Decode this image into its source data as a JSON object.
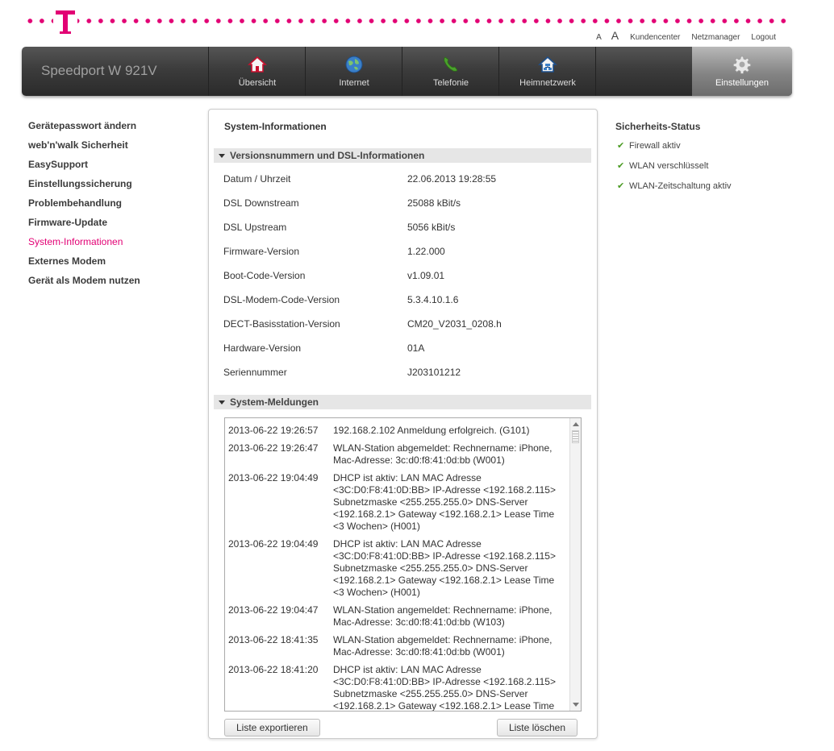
{
  "brand": {
    "product": "Speedport W 921V",
    "accent": "#e20074"
  },
  "toplinks": {
    "a_small": "A",
    "a_big": "A",
    "kundencenter": "Kundencenter",
    "netzmanager": "Netzmanager",
    "logout": "Logout"
  },
  "nav": [
    {
      "label": "Übersicht",
      "icon": "home-icon"
    },
    {
      "label": "Internet",
      "icon": "globe-icon"
    },
    {
      "label": "Telefonie",
      "icon": "phone-icon"
    },
    {
      "label": "Heimnetzwerk",
      "icon": "network-house-icon"
    },
    {
      "label": "Einstellungen",
      "icon": "gear-icon",
      "active": true
    }
  ],
  "sidebar": {
    "items": [
      {
        "label": "Gerätepasswort ändern"
      },
      {
        "label": "web'n'walk Sicherheit"
      },
      {
        "label": "EasySupport"
      },
      {
        "label": "Einstellungssicherung"
      },
      {
        "label": "Problembehandlung"
      },
      {
        "label": "Firmware-Update"
      },
      {
        "label": "System-Informationen",
        "selected": true
      },
      {
        "label": "Externes Modem"
      },
      {
        "label": "Gerät als Modem nutzen"
      }
    ]
  },
  "main": {
    "title": "System-Informationen",
    "versions_header": "Versionsnummern und DSL-Informationen",
    "info": [
      {
        "key": "Datum / Uhrzeit",
        "value": "22.06.2013 19:28:55"
      },
      {
        "key": "DSL Downstream",
        "value": "25088 kBit/s"
      },
      {
        "key": "DSL Upstream",
        "value": "5056 kBit/s"
      },
      {
        "key": "Firmware-Version",
        "value": "1.22.000"
      },
      {
        "key": "Boot-Code-Version",
        "value": "v1.09.01"
      },
      {
        "key": "DSL-Modem-Code-Version",
        "value": "5.3.4.10.1.6"
      },
      {
        "key": "DECT-Basisstation-Version",
        "value": "CM20_V2031_0208.h"
      },
      {
        "key": "Hardware-Version",
        "value": "01A"
      },
      {
        "key": "Seriennummer",
        "value": "J203101212"
      }
    ],
    "log_header": "System-Meldungen",
    "log": [
      {
        "ts": "2013-06-22 19:26:57",
        "msg": "192.168.2.102 Anmeldung erfolgreich. (G101)"
      },
      {
        "ts": "2013-06-22 19:26:47",
        "msg": "WLAN-Station abgemeldet: Rechnername: iPhone,\nMac-Adresse: 3c:d0:f8:41:0d:bb (W001)"
      },
      {
        "ts": "2013-06-22 19:04:49",
        "msg": "DHCP ist aktiv: LAN MAC Adresse\n<3C:D0:F8:41:0D:BB> IP-Adresse <192.168.2.115>\nSubnetzmaske <255.255.255.0> DNS-Server\n<192.168.2.1> Gateway <192.168.2.1> Lease Time\n<3 Wochen> (H001)"
      },
      {
        "ts": "2013-06-22 19:04:49",
        "msg": "DHCP ist aktiv: LAN MAC Adresse\n<3C:D0:F8:41:0D:BB> IP-Adresse <192.168.2.115>\nSubnetzmaske <255.255.255.0> DNS-Server\n<192.168.2.1> Gateway <192.168.2.1> Lease Time\n<3 Wochen> (H001)"
      },
      {
        "ts": "2013-06-22 19:04:47",
        "msg": "WLAN-Station angemeldet: Rechnername: iPhone,\nMac-Adresse: 3c:d0:f8:41:0d:bb (W103)"
      },
      {
        "ts": "2013-06-22 18:41:35",
        "msg": "WLAN-Station abgemeldet: Rechnername: iPhone,\nMac-Adresse: 3c:d0:f8:41:0d:bb (W001)"
      },
      {
        "ts": "2013-06-22 18:41:20",
        "msg": "DHCP ist aktiv: LAN MAC Adresse\n<3C:D0:F8:41:0D:BB> IP-Adresse <192.168.2.115>\nSubnetzmaske <255.255.255.0> DNS-Server\n<192.168.2.1> Gateway <192.168.2.1> Lease Time"
      }
    ],
    "export_button": "Liste exportieren",
    "clear_button": "Liste löschen"
  },
  "security": {
    "title": "Sicherheits-Status",
    "items": [
      {
        "label": "Firewall aktiv"
      },
      {
        "label": "WLAN verschlüsselt"
      },
      {
        "label": "WLAN-Zeitschaltung aktiv"
      }
    ]
  }
}
